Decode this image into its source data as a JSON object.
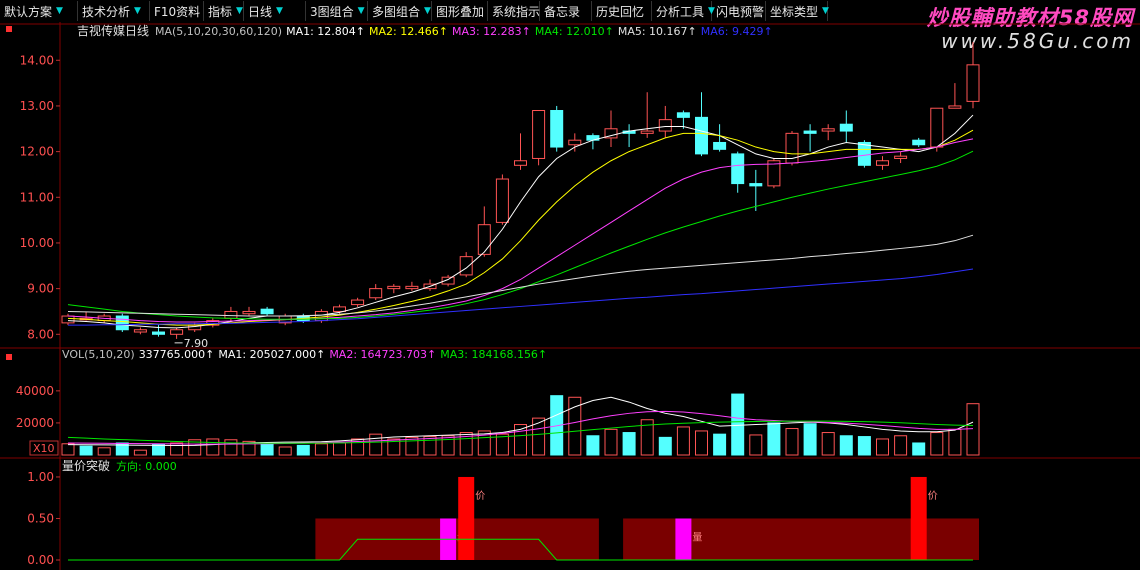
{
  "toolbar": [
    {
      "label": "默认方案",
      "dropdown": true
    },
    {
      "label": "技术分析",
      "dropdown": true
    },
    {
      "label": "F10资料",
      "dropdown": false
    },
    {
      "label": "指标",
      "dropdown": true
    },
    {
      "label": "日线",
      "dropdown": true
    },
    {
      "label": "3图组合",
      "dropdown": true
    },
    {
      "label": "多图组合",
      "dropdown": true
    },
    {
      "label": "图形叠加",
      "dropdown": false
    },
    {
      "label": "系统指示",
      "dropdown": false
    },
    {
      "label": "备忘录",
      "dropdown": false
    },
    {
      "label": "历史回忆",
      "dropdown": false
    },
    {
      "label": "分析工具",
      "dropdown": true
    },
    {
      "label": "闪电预警",
      "dropdown": false
    },
    {
      "label": "坐标类型",
      "dropdown": true
    }
  ],
  "watermark": {
    "line1": "炒股輔助教材58股网",
    "line2": "www.58Gu.com"
  },
  "colors": {
    "up": "#ff5454",
    "up_fill": "#000000",
    "down": "#54ffff",
    "ma1": "#ffffff",
    "ma2": "#ffff00",
    "ma3": "#ff40ff",
    "ma4": "#00e600",
    "ma5": "#e0e0e0",
    "ma6": "#3030ff",
    "grid": "#800000"
  },
  "chart_data": [
    {
      "type": "candlestick",
      "title": "吉视传媒日线",
      "legend_items": [
        {
          "text": "MA(5,10,20,30,60,120)",
          "color": "#c0c0c0"
        },
        {
          "text": "MA1: 12.804↑",
          "color": "#ffffff"
        },
        {
          "text": "MA2: 12.466↑",
          "color": "#ffff00"
        },
        {
          "text": "MA3: 12.283↑",
          "color": "#ff40ff"
        },
        {
          "text": "MA4: 12.010↑",
          "color": "#00e600"
        },
        {
          "text": "MA5: 10.167↑",
          "color": "#e0e0e0"
        },
        {
          "text": "MA6: 9.429↑",
          "color": "#3030ff"
        }
      ],
      "y_ticks": [
        "8.00",
        "9.00",
        "10.00",
        "11.00",
        "12.00",
        "13.00",
        "14.00"
      ],
      "ylim": [
        7.7,
        14.4
      ],
      "low_label": "7.90",
      "candles": [
        [
          8.25,
          8.4,
          8.45,
          8.2
        ],
        [
          8.35,
          8.35,
          8.5,
          8.3
        ],
        [
          8.3,
          8.4,
          8.45,
          8.25
        ],
        [
          8.4,
          8.1,
          8.45,
          8.05
        ],
        [
          8.05,
          8.1,
          8.15,
          8.0
        ],
        [
          8.05,
          8.0,
          8.2,
          7.95
        ],
        [
          8.0,
          8.1,
          8.15,
          7.9
        ],
        [
          8.1,
          8.2,
          8.25,
          8.05
        ],
        [
          8.2,
          8.3,
          8.35,
          8.15
        ],
        [
          8.35,
          8.5,
          8.6,
          8.3
        ],
        [
          8.45,
          8.5,
          8.6,
          8.4
        ],
        [
          8.55,
          8.45,
          8.6,
          8.4
        ],
        [
          8.25,
          8.4,
          8.45,
          8.2
        ],
        [
          8.4,
          8.3,
          8.45,
          8.25
        ],
        [
          8.3,
          8.5,
          8.55,
          8.25
        ],
        [
          8.5,
          8.6,
          8.65,
          8.45
        ],
        [
          8.65,
          8.75,
          8.8,
          8.6
        ],
        [
          8.8,
          9.0,
          9.1,
          8.75
        ],
        [
          9.0,
          9.05,
          9.1,
          8.9
        ],
        [
          9.0,
          9.05,
          9.15,
          8.95
        ],
        [
          9.0,
          9.1,
          9.2,
          8.95
        ],
        [
          9.1,
          9.25,
          9.3,
          9.05
        ],
        [
          9.3,
          9.7,
          9.8,
          9.25
        ],
        [
          9.75,
          10.4,
          10.8,
          9.7
        ],
        [
          10.45,
          11.4,
          11.5,
          10.4
        ],
        [
          11.7,
          11.8,
          12.4,
          11.6
        ],
        [
          11.85,
          12.9,
          12.9,
          11.7
        ],
        [
          12.9,
          12.1,
          13.0,
          12.0
        ],
        [
          12.15,
          12.25,
          12.4,
          12.0
        ],
        [
          12.35,
          12.25,
          12.4,
          12.05
        ],
        [
          12.3,
          12.5,
          12.9,
          12.1
        ],
        [
          12.45,
          12.4,
          12.6,
          12.1
        ],
        [
          12.4,
          12.45,
          13.3,
          12.3
        ],
        [
          12.45,
          12.7,
          13.0,
          12.3
        ],
        [
          12.85,
          12.75,
          12.9,
          12.5
        ],
        [
          12.75,
          11.95,
          13.3,
          11.9
        ],
        [
          12.2,
          12.05,
          12.6,
          12.0
        ],
        [
          11.95,
          11.3,
          12.0,
          11.1
        ],
        [
          11.3,
          11.25,
          11.6,
          10.7
        ],
        [
          11.25,
          11.8,
          11.85,
          11.2
        ],
        [
          11.75,
          12.4,
          12.45,
          11.7
        ],
        [
          12.45,
          12.4,
          12.6,
          12.0
        ],
        [
          12.45,
          12.5,
          12.6,
          12.25
        ],
        [
          12.6,
          12.45,
          12.9,
          12.2
        ],
        [
          12.2,
          11.7,
          12.25,
          11.65
        ],
        [
          11.7,
          11.8,
          11.9,
          11.6
        ],
        [
          11.85,
          11.9,
          12.0,
          11.75
        ],
        [
          12.25,
          12.15,
          12.3,
          12.1
        ],
        [
          12.1,
          12.95,
          12.95,
          12.0
        ],
        [
          12.95,
          13.0,
          13.5,
          12.95
        ],
        [
          13.1,
          13.9,
          14.4,
          12.95
        ]
      ],
      "ma": {
        "ma1": [
          8.3,
          8.28,
          8.25,
          8.2,
          8.18,
          8.15,
          8.14,
          8.17,
          8.22,
          8.28,
          8.35,
          8.4,
          8.4,
          8.4,
          8.42,
          8.48,
          8.58,
          8.7,
          8.82,
          8.92,
          9.05,
          9.2,
          9.45,
          9.8,
          10.3,
          10.9,
          11.45,
          11.85,
          12.1,
          12.25,
          12.35,
          12.45,
          12.5,
          12.55,
          12.55,
          12.45,
          12.35,
          12.15,
          11.95,
          11.85,
          11.85,
          11.95,
          12.1,
          12.2,
          12.15,
          12.1,
          12.05,
          12.0,
          12.1,
          12.4,
          12.8
        ],
        "ma2": [
          8.35,
          8.33,
          8.3,
          8.28,
          8.25,
          8.22,
          8.2,
          8.2,
          8.22,
          8.25,
          8.28,
          8.3,
          8.32,
          8.35,
          8.38,
          8.42,
          8.48,
          8.55,
          8.63,
          8.72,
          8.82,
          8.95,
          9.1,
          9.35,
          9.65,
          10.05,
          10.5,
          10.9,
          11.25,
          11.55,
          11.8,
          12.0,
          12.15,
          12.3,
          12.4,
          12.4,
          12.35,
          12.25,
          12.1,
          12.0,
          11.95,
          11.95,
          12.0,
          12.05,
          12.05,
          12.05,
          12.05,
          12.05,
          12.1,
          12.25,
          12.47
        ],
        "ma3": [
          8.4,
          8.38,
          8.35,
          8.33,
          8.3,
          8.28,
          8.27,
          8.27,
          8.28,
          8.29,
          8.3,
          8.31,
          8.32,
          8.33,
          8.35,
          8.37,
          8.4,
          8.43,
          8.47,
          8.52,
          8.58,
          8.65,
          8.73,
          8.85,
          9.0,
          9.2,
          9.45,
          9.7,
          9.95,
          10.2,
          10.45,
          10.7,
          10.95,
          11.2,
          11.4,
          11.55,
          11.65,
          11.7,
          11.72,
          11.73,
          11.75,
          11.78,
          11.82,
          11.87,
          11.92,
          11.97,
          12.0,
          12.05,
          12.1,
          12.2,
          12.28
        ],
        "ma4": [
          8.65,
          8.6,
          8.55,
          8.5,
          8.46,
          8.43,
          8.4,
          8.38,
          8.36,
          8.35,
          8.34,
          8.33,
          8.33,
          8.33,
          8.34,
          8.35,
          8.37,
          8.4,
          8.44,
          8.48,
          8.53,
          8.59,
          8.67,
          8.76,
          8.87,
          9.0,
          9.15,
          9.3,
          9.46,
          9.62,
          9.78,
          9.93,
          10.08,
          10.22,
          10.35,
          10.47,
          10.59,
          10.7,
          10.8,
          10.9,
          11.0,
          11.09,
          11.18,
          11.26,
          11.34,
          11.42,
          11.5,
          11.58,
          11.68,
          11.82,
          12.01
        ],
        "ma5": [
          8.5,
          8.49,
          8.48,
          8.47,
          8.46,
          8.45,
          8.44,
          8.43,
          8.42,
          8.41,
          8.4,
          8.4,
          8.4,
          8.41,
          8.42,
          8.44,
          8.47,
          8.51,
          8.56,
          8.62,
          8.68,
          8.75,
          8.82,
          8.89,
          8.96,
          9.03,
          9.1,
          9.16,
          9.22,
          9.28,
          9.33,
          9.38,
          9.42,
          9.45,
          9.48,
          9.51,
          9.54,
          9.57,
          9.6,
          9.63,
          9.66,
          9.7,
          9.73,
          9.77,
          9.8,
          9.84,
          9.88,
          9.92,
          9.97,
          10.05,
          10.17
        ],
        "ma6": [
          8.2,
          8.2,
          8.21,
          8.21,
          8.22,
          8.22,
          8.23,
          8.23,
          8.24,
          8.24,
          8.25,
          8.26,
          8.27,
          8.28,
          8.3,
          8.32,
          8.34,
          8.37,
          8.4,
          8.43,
          8.46,
          8.49,
          8.52,
          8.55,
          8.58,
          8.61,
          8.64,
          8.67,
          8.7,
          8.73,
          8.76,
          8.79,
          8.81,
          8.84,
          8.87,
          8.89,
          8.92,
          8.95,
          8.98,
          9.01,
          9.04,
          9.07,
          9.1,
          9.13,
          9.16,
          9.19,
          9.22,
          9.26,
          9.31,
          9.37,
          9.43
        ]
      }
    },
    {
      "type": "bar",
      "legend_items": [
        {
          "text": "VOL(5,10,20)",
          "color": "#c0c0c0"
        },
        {
          "text": "337765.000↑",
          "color": "#ffffff"
        },
        {
          "text": "MA1: 205027.000↑",
          "color": "#ffffff"
        },
        {
          "text": "MA2: 164723.703↑",
          "color": "#ff40ff"
        },
        {
          "text": "MA3: 184168.156↑",
          "color": "#00e600"
        }
      ],
      "y_ticks": [
        "20000",
        "40000"
      ],
      "unit_label": "X10",
      "ylim": [
        0,
        58000
      ],
      "values": [
        7000,
        5500,
        4500,
        7500,
        3000,
        6500,
        7500,
        9500,
        10000,
        9500,
        8500,
        7000,
        5000,
        6000,
        7000,
        7500,
        10000,
        13000,
        10000,
        11000,
        11500,
        12000,
        14000,
        15000,
        13000,
        19000,
        23000,
        37000,
        36000,
        12000,
        16000,
        14000,
        22000,
        11000,
        17500,
        15000,
        13000,
        38000,
        12500,
        20000,
        16500,
        19500,
        14000,
        12000,
        11500,
        10000,
        12000,
        7500,
        14000,
        16000,
        32000
      ],
      "up": [
        true,
        false,
        true,
        false,
        true,
        false,
        true,
        true,
        true,
        true,
        true,
        false,
        true,
        false,
        true,
        true,
        true,
        true,
        true,
        true,
        true,
        true,
        true,
        true,
        true,
        true,
        true,
        false,
        true,
        false,
        true,
        false,
        true,
        false,
        true,
        true,
        false,
        false,
        true,
        false,
        true,
        false,
        true,
        false,
        false,
        true,
        true,
        false,
        true,
        true,
        true
      ],
      "ma": {
        "ma1": [
          6500,
          6400,
          6300,
          6200,
          6100,
          6000,
          5900,
          6000,
          6500,
          7000,
          7600,
          7800,
          8000,
          8100,
          8300,
          8800,
          9500,
          10400,
          11200,
          11600,
          12000,
          12400,
          12800,
          13200,
          14000,
          16000,
          20000,
          25000,
          30000,
          34000,
          36000,
          33000,
          29000,
          26000,
          24000,
          21000,
          18000,
          18500,
          19000,
          19500,
          20000,
          20500,
          20000,
          19000,
          17500,
          16000,
          15000,
          14500,
          14500,
          15500,
          20500
        ],
        "ma2": [
          7500,
          7400,
          7300,
          7200,
          7100,
          7000,
          6900,
          6800,
          6800,
          6800,
          6900,
          7000,
          7200,
          7400,
          7700,
          8000,
          8400,
          8800,
          9300,
          9800,
          10300,
          10800,
          11500,
          12400,
          13500,
          14800,
          16400,
          18200,
          20300,
          22500,
          24500,
          26000,
          27000,
          27200,
          26800,
          25800,
          24500,
          23000,
          22000,
          21500,
          21000,
          20700,
          20300,
          19900,
          19200,
          18400,
          17500,
          16600,
          16000,
          16000,
          16472
        ],
        "ma3": [
          11000,
          10500,
          10000,
          9600,
          9200,
          8800,
          8400,
          8100,
          7800,
          7600,
          7400,
          7300,
          7300,
          7300,
          7400,
          7500,
          7700,
          8000,
          8400,
          8800,
          9200,
          9700,
          10200,
          10800,
          11400,
          12100,
          12900,
          13800,
          14800,
          15800,
          16800,
          17800,
          18600,
          19300,
          19800,
          20200,
          20500,
          20700,
          20900,
          21000,
          21100,
          21100,
          21100,
          21000,
          20800,
          20500,
          20100,
          19600,
          19000,
          18600,
          18417
        ]
      }
    },
    {
      "type": "indicator",
      "title": "量价突破",
      "legend_items": [
        {
          "text": "方向: 0.000",
          "color": "#00e600"
        }
      ],
      "y_ticks": [
        "0.00",
        "0.50",
        "1.00"
      ],
      "ylim": [
        0,
        1.12
      ],
      "zones": [
        {
          "start": 14,
          "end": 29,
          "value": 0.5
        },
        {
          "start": 31,
          "end": 50,
          "value": 0.5
        }
      ],
      "signals": [
        {
          "index": 21,
          "value": 0.5,
          "color": "#ff00ff",
          "label": "量"
        },
        {
          "index": 22,
          "value": 1.0,
          "color": "#ff0000",
          "label": "价"
        },
        {
          "index": 34,
          "value": 0.5,
          "color": "#ff00ff",
          "label": "量"
        },
        {
          "index": 47,
          "value": 1.0,
          "color": "#ff0000",
          "label": "价"
        }
      ],
      "line_values": [
        0,
        0,
        0,
        0,
        0,
        0,
        0,
        0,
        0,
        0,
        0,
        0,
        0,
        0,
        0,
        0,
        0.25,
        0.25,
        0.25,
        0.25,
        0.25,
        0.25,
        0.25,
        0.25,
        0.25,
        0.25,
        0.25,
        0,
        0,
        0,
        0,
        0,
        0,
        0,
        0,
        0,
        0,
        0,
        0,
        0,
        0,
        0,
        0,
        0,
        0,
        0,
        0,
        0,
        0,
        0,
        0
      ]
    }
  ]
}
